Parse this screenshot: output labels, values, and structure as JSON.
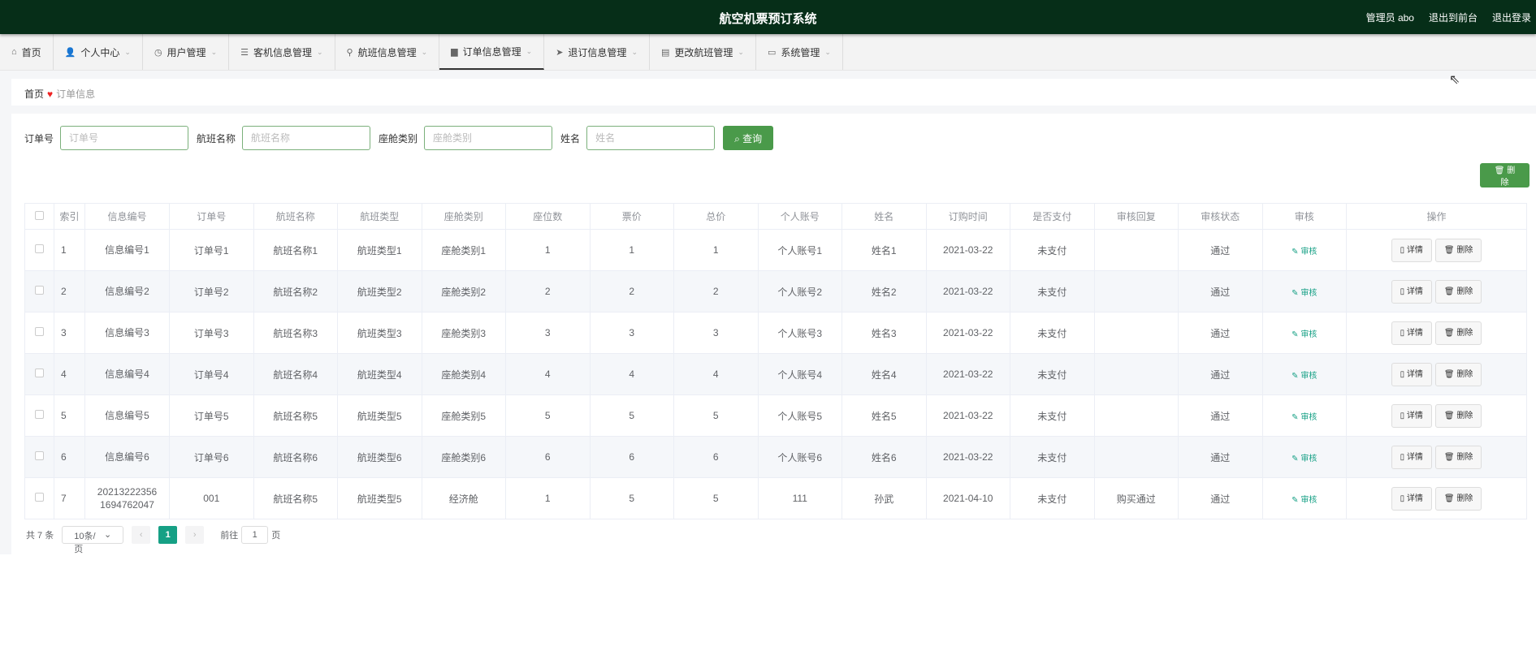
{
  "header": {
    "title": "航空机票预订系统",
    "user": "管理员 abo",
    "to_front": "退出到前台",
    "logout": "退出登录"
  },
  "nav": [
    {
      "label": "首页",
      "icon": "home-icon"
    },
    {
      "label": "个人中心",
      "icon": "user-icon"
    },
    {
      "label": "用户管理",
      "icon": "clock-icon"
    },
    {
      "label": "客机信息管理",
      "icon": "list-icon"
    },
    {
      "label": "航班信息管理",
      "icon": "person-icon"
    },
    {
      "label": "订单信息管理",
      "icon": "printer-icon"
    },
    {
      "label": "退订信息管理",
      "icon": "send-icon"
    },
    {
      "label": "更改航班管理",
      "icon": "clipboard-icon"
    },
    {
      "label": "系统管理",
      "icon": "chat-icon"
    }
  ],
  "breadcrumb": {
    "home": "首页",
    "current": "订单信息"
  },
  "search": {
    "fields": [
      {
        "label": "订单号",
        "placeholder": "订单号"
      },
      {
        "label": "航班名称",
        "placeholder": "航班名称"
      },
      {
        "label": "座舱类别",
        "placeholder": "座舱类别"
      },
      {
        "label": "姓名",
        "placeholder": "姓名"
      }
    ],
    "query": "查询"
  },
  "delete_label": "删除",
  "table": {
    "headers": [
      "索引",
      "信息编号",
      "订单号",
      "航班名称",
      "航班类型",
      "座舱类别",
      "座位数",
      "票价",
      "总价",
      "个人账号",
      "姓名",
      "订购时间",
      "是否支付",
      "审核回复",
      "审核状态",
      "审核",
      "操作"
    ],
    "rows": [
      [
        "1",
        "信息编号1",
        "订单号1",
        "航班名称1",
        "航班类型1",
        "座舱类别1",
        "1",
        "1",
        "1",
        "个人账号1",
        "姓名1",
        "2021-03-22",
        "未支付",
        "",
        "通过"
      ],
      [
        "2",
        "信息编号2",
        "订单号2",
        "航班名称2",
        "航班类型2",
        "座舱类别2",
        "2",
        "2",
        "2",
        "个人账号2",
        "姓名2",
        "2021-03-22",
        "未支付",
        "",
        "通过"
      ],
      [
        "3",
        "信息编号3",
        "订单号3",
        "航班名称3",
        "航班类型3",
        "座舱类别3",
        "3",
        "3",
        "3",
        "个人账号3",
        "姓名3",
        "2021-03-22",
        "未支付",
        "",
        "通过"
      ],
      [
        "4",
        "信息编号4",
        "订单号4",
        "航班名称4",
        "航班类型4",
        "座舱类别4",
        "4",
        "4",
        "4",
        "个人账号4",
        "姓名4",
        "2021-03-22",
        "未支付",
        "",
        "通过"
      ],
      [
        "5",
        "信息编号5",
        "订单号5",
        "航班名称5",
        "航班类型5",
        "座舱类别5",
        "5",
        "5",
        "5",
        "个人账号5",
        "姓名5",
        "2021-03-22",
        "未支付",
        "",
        "通过"
      ],
      [
        "6",
        "信息编号6",
        "订单号6",
        "航班名称6",
        "航班类型6",
        "座舱类别6",
        "6",
        "6",
        "6",
        "个人账号6",
        "姓名6",
        "2021-03-22",
        "未支付",
        "",
        "通过"
      ],
      [
        "7",
        "202132223561694762047",
        "001",
        "航班名称5",
        "航班类型5",
        "经济舱",
        "1",
        "5",
        "5",
        "111",
        "孙武",
        "2021-04-10",
        "未支付",
        "购买通过",
        "通过"
      ]
    ],
    "audit_label": "审核",
    "detail_label": "详情",
    "delete_label": "删除"
  },
  "pagination": {
    "total": "共 7 条",
    "page_size": "10条/页",
    "current": "1",
    "goto": "前往",
    "goto_value": "1",
    "page_suffix": "页"
  }
}
